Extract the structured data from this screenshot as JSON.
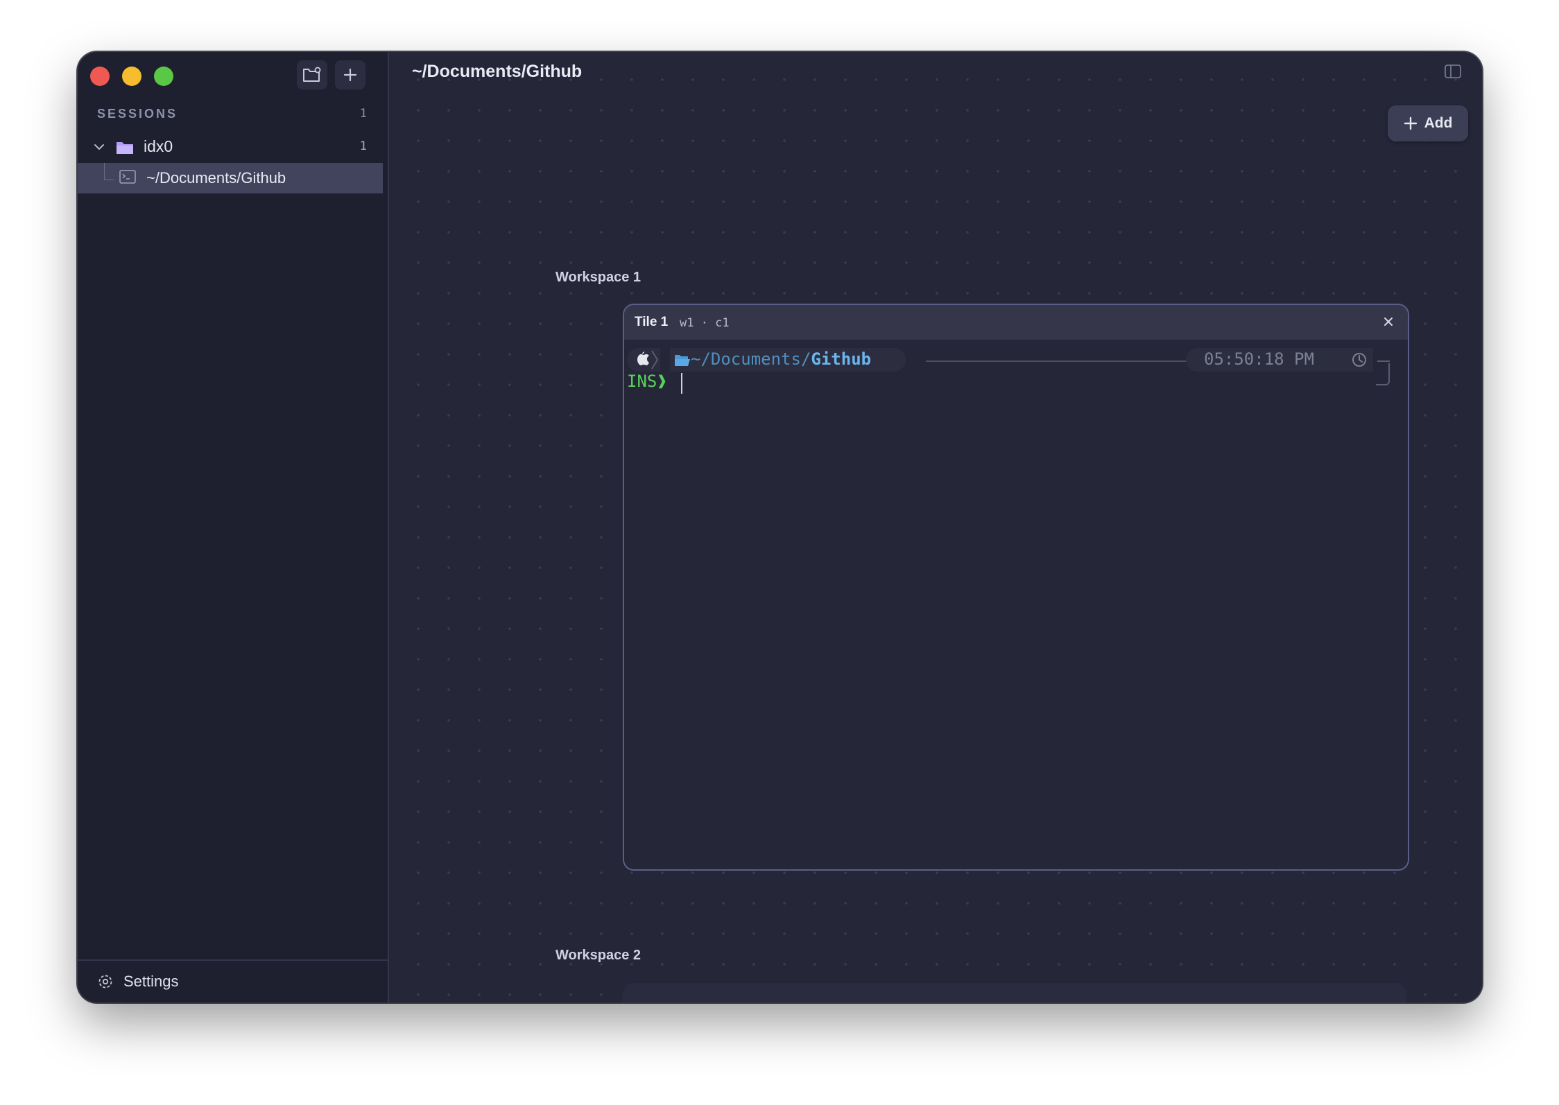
{
  "sidebar": {
    "sessions_label": "SESSIONS",
    "sessions_count": "1",
    "group": {
      "name": "idx0",
      "count": "1"
    },
    "session": {
      "label": "~/Documents/Github"
    },
    "settings_label": "Settings"
  },
  "main": {
    "title": "~/Documents/Github",
    "add_label": "Add"
  },
  "workspaces": [
    {
      "label": "Workspace 1",
      "tile": {
        "name": "Tile 1",
        "meta": "w1 · c1",
        "prompt": {
          "path_prefix": "~/Documents/",
          "path_current": "Github",
          "time": "05:50:18 PM",
          "mode": "INS❱"
        }
      }
    },
    {
      "label": "Workspace 2"
    }
  ],
  "colors": {
    "background": "#252638",
    "sidebar": "#1e1f2f",
    "selected_row": "#42445d",
    "folder_accent": "#b49cf5",
    "prompt_path": "#6cb6f0",
    "prompt_mode": "#58d05c"
  }
}
